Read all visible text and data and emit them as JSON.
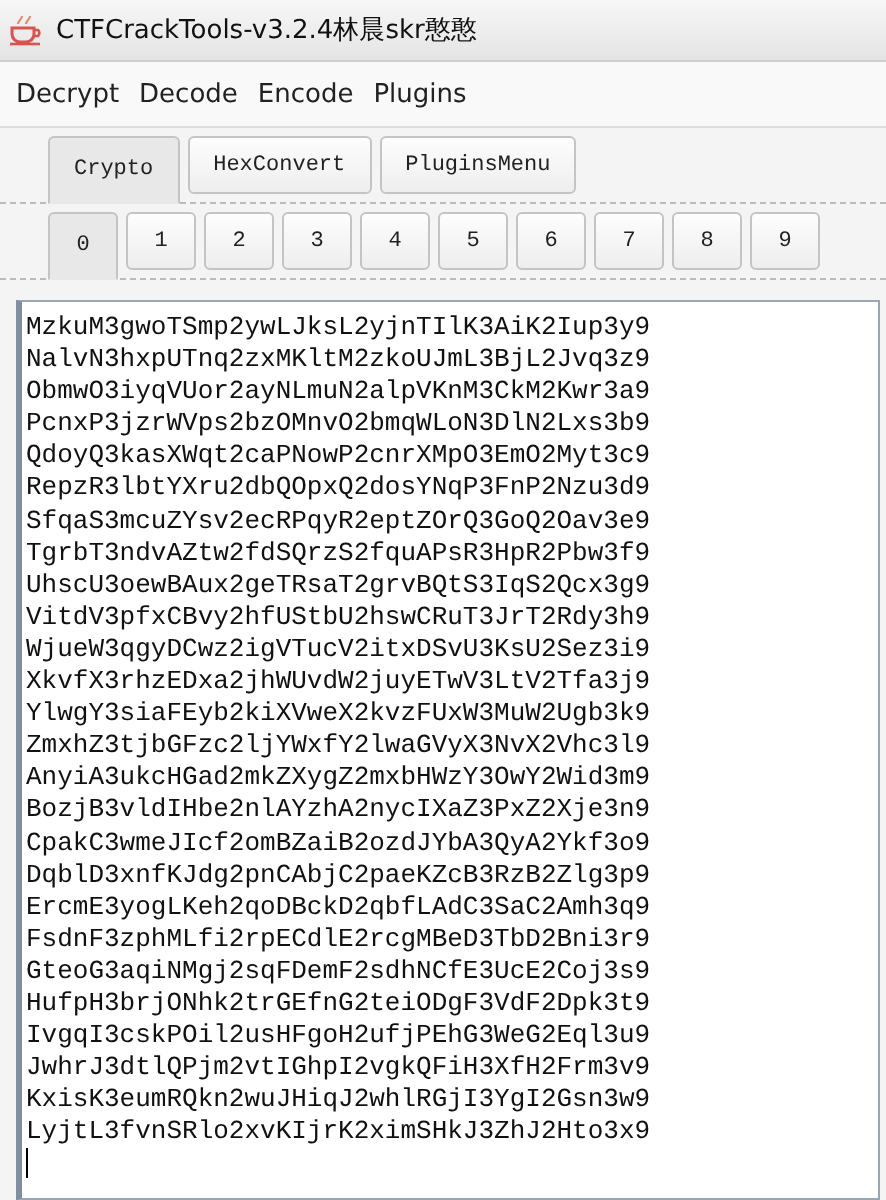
{
  "window": {
    "title": "CTFCrackTools-v3.2.4林晨skr憨憨"
  },
  "menu": [
    "Decrypt",
    "Decode",
    "Encode",
    "Plugins"
  ],
  "tabs": [
    {
      "label": "Crypto",
      "selected": true
    },
    {
      "label": "HexConvert",
      "selected": false
    },
    {
      "label": "PluginsMenu",
      "selected": false
    }
  ],
  "sub_tabs": [
    {
      "label": "0",
      "selected": true
    },
    {
      "label": "1",
      "selected": false
    },
    {
      "label": "2",
      "selected": false
    },
    {
      "label": "3",
      "selected": false
    },
    {
      "label": "4",
      "selected": false
    },
    {
      "label": "5",
      "selected": false
    },
    {
      "label": "6",
      "selected": false
    },
    {
      "label": "7",
      "selected": false
    },
    {
      "label": "8",
      "selected": false
    },
    {
      "label": "9",
      "selected": false
    }
  ],
  "output_lines": [
    "MzkuM3gwoTSmp2ywLJksL2yjnTIlK3AiK2Iup3y9",
    "NalvN3hxpUTnq2zxMKltM2zkoUJmL3BjL2Jvq3z9",
    "ObmwO3iyqVUor2ayNLmuN2alpVKnM3CkM2Kwr3a9",
    "PcnxP3jzrWVps2bzOMnvO2bmqWLoN3DlN2Lxs3b9",
    "QdoyQ3kasXWqt2caPNowP2cnrXMpO3EmO2Myt3c9",
    "RepzR3lbtYXru2dbQOpxQ2dosYNqP3FnP2Nzu3d9",
    "SfqaS3mcuZYsv2ecRPqyR2eptZOrQ3GoQ2Oav3e9",
    "TgrbT3ndvAZtw2fdSQrzS2fquAPsR3HpR2Pbw3f9",
    "UhscU3oewBAux2geTRsaT2grvBQtS3IqS2Qcx3g9",
    "VitdV3pfxCBvy2hfUStbU2hswCRuT3JrT2Rdy3h9",
    "WjueW3qgyDCwz2igVTucV2itxDSvU3KsU2Sez3i9",
    "XkvfX3rhzEDxa2jhWUvdW2juyETwV3LtV2Tfa3j9",
    "YlwgY3siaFEyb2kiXVweX2kvzFUxW3MuW2Ugb3k9",
    "ZmxhZ3tjbGFzc2ljYWxfY2lwaGVyX3NvX2Vhc3l9",
    "AnyiA3ukcHGad2mkZXygZ2mxbHWzY3OwY2Wid3m9",
    "BozjB3vldIHbe2nlAYzhA2nycIXaZ3PxZ2Xje3n9",
    "CpakC3wmeJIcf2omBZaiB2ozdJYbA3QyA2Ykf3o9",
    "DqblD3xnfKJdg2pnCAbjC2paeKZcB3RzB2Zlg3p9",
    "ErcmE3yogLKeh2qoDBckD2qbfLAdC3SaC2Amh3q9",
    "FsdnF3zphMLfi2rpECdlE2rcgMBeD3TbD2Bni3r9",
    "GteoG3aqiNMgj2sqFDemF2sdhNCfE3UcE2Coj3s9",
    "HufpH3brjONhk2trGEfnG2teiODgF3VdF2Dpk3t9",
    "IvgqI3cskPOil2usHFgoH2ufjPEhG3WeG2Eql3u9",
    "JwhrJ3dtlQPjm2vtIGhpI2vgkQFiH3XfH2Frm3v9",
    "KxisK3eumRQkn2wuJHiqJ2whlRGjI3YgI2Gsn3w9",
    "LyjtL3fvnSRlo2xvKIjrK2ximSHkJ3ZhJ2Hto3x9"
  ]
}
